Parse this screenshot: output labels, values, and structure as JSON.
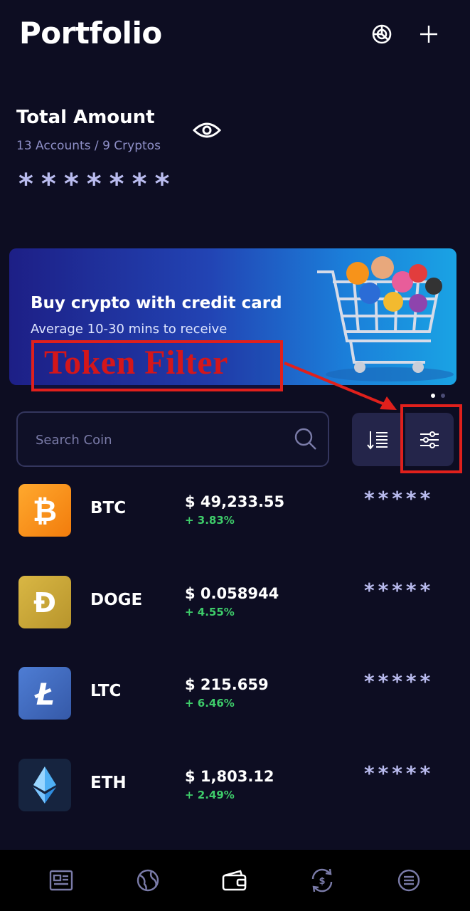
{
  "header": {
    "title": "Portfolio",
    "icons": [
      "pie-chart-icon",
      "plus-icon"
    ]
  },
  "total": {
    "label": "Total Amount",
    "sub": "13 Accounts / 9 Cryptos",
    "masked_value": "*******"
  },
  "banner": {
    "title": "Buy crypto with credit card",
    "subtitle": "Average 10-30 mins to receive",
    "page_count": 2,
    "active_page": 1
  },
  "annotation": {
    "label": "Token Filter",
    "color": "#e0201c"
  },
  "search": {
    "placeholder": "Search Coin",
    "value": ""
  },
  "coins": [
    {
      "symbol": "BTC",
      "price": "$ 49,233.55",
      "change": "+ 3.83%",
      "masked": "*****",
      "color": "#f7931a",
      "icon": "bitcoin-icon"
    },
    {
      "symbol": "DOGE",
      "price": "$ 0.058944",
      "change": "+ 4.55%",
      "masked": "*****",
      "color": "#c9a835",
      "icon": "dogecoin-icon"
    },
    {
      "symbol": "LTC",
      "price": "$ 215.659",
      "change": "+ 6.46%",
      "masked": "*****",
      "color": "#3f6bc0",
      "icon": "litecoin-icon"
    },
    {
      "symbol": "ETH",
      "price": "$ 1,803.12",
      "change": "+ 2.49%",
      "masked": "*****",
      "color": "#1a2a48",
      "icon": "ethereum-icon"
    }
  ],
  "nav": {
    "items": [
      "news-icon",
      "markets-icon",
      "wallet-icon",
      "swap-icon",
      "menu-icon"
    ],
    "active": "wallet-icon"
  },
  "colors": {
    "background": "#0d0d22",
    "accent_text": "#b9bbee",
    "positive": "#3ecc6a"
  }
}
